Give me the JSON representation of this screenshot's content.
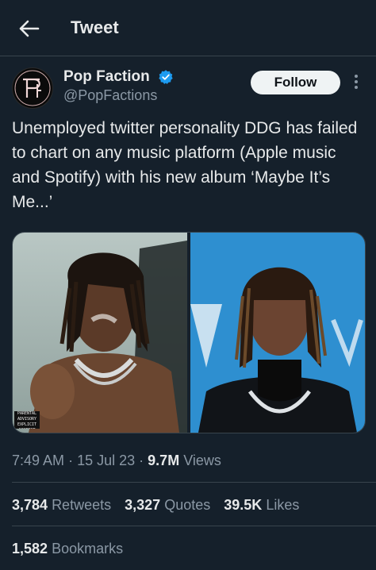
{
  "header": {
    "title": "Tweet",
    "back_icon": "back-arrow-icon"
  },
  "author": {
    "name": "Pop Faction",
    "handle": "@PopFactions",
    "verified": true,
    "avatar_letters": "PF"
  },
  "actions": {
    "follow_label": "Follow",
    "more_icon": "more-vertical-icon"
  },
  "tweet": {
    "text": "Unemployed twitter personality DDG has failed to chart on any music platform (Apple music and Spotify) with his new album ‘Maybe It’s Me...’"
  },
  "media": {
    "count": 2,
    "advisory_text": "PARENTAL ADVISORY EXPLICIT CONTENT"
  },
  "meta": {
    "time": "7:49 AM",
    "date": "15 Jul 23",
    "views_count": "9.7M",
    "views_label": "Views",
    "separator": "·"
  },
  "stats": {
    "retweets_count": "3,784",
    "retweets_label": "Retweets",
    "quotes_count": "3,327",
    "quotes_label": "Quotes",
    "likes_count": "39.5K",
    "likes_label": "Likes",
    "bookmarks_count": "1,582",
    "bookmarks_label": "Bookmarks"
  },
  "colors": {
    "background": "#15202b",
    "text": "#e7e9ea",
    "muted": "#8b98a5",
    "divider": "#38444d",
    "verified": "#1d9bf0",
    "follow_bg": "#eff3f4"
  }
}
